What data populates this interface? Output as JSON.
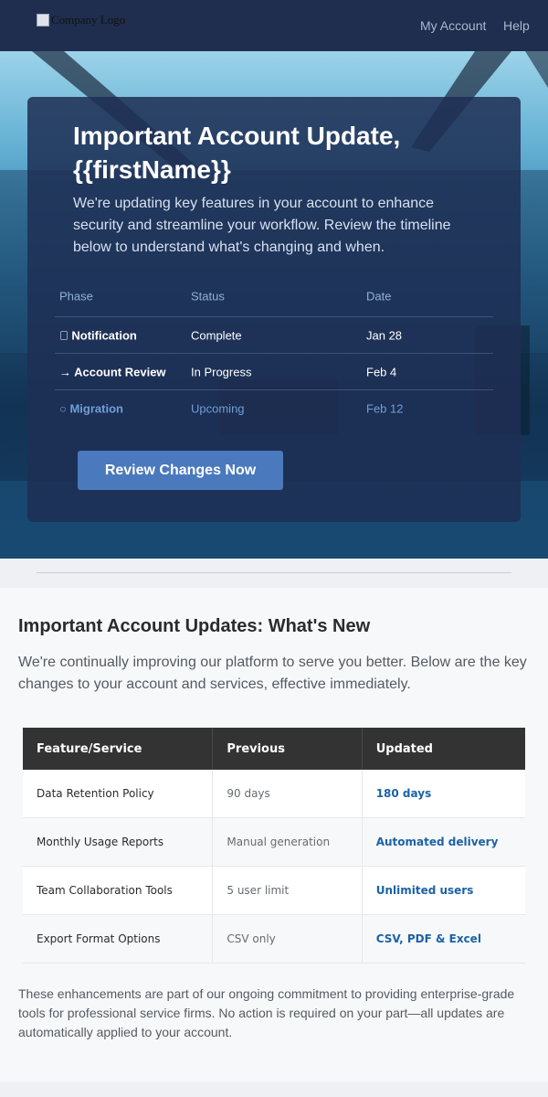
{
  "header": {
    "logo_alt": "Company Logo",
    "nav": [
      {
        "label": "My Account"
      },
      {
        "label": "Help"
      }
    ]
  },
  "hero": {
    "title": "Important Account Update, {{firstName}}",
    "subtitle": "We're updating key features in your account to enhance security and streamline your workflow. Review the timeline below to understand what's changing and when.",
    "timeline": {
      "headers": [
        "Phase",
        "Status",
        "Date"
      ],
      "rows": [
        {
          "phase": " Notification",
          "status": "Complete",
          "date": "Jan 28"
        },
        {
          "phase": "→ Account Review",
          "status": "In Progress",
          "date": "Feb 4"
        },
        {
          "phase": "○ Migration",
          "status": "Upcoming",
          "date": "Feb 12"
        }
      ]
    },
    "cta_label": "Review Changes Now"
  },
  "main": {
    "title": "Important Account Updates: What's New",
    "intro": "We're continually improving our platform to serve you better. Below are the key changes to your account and services, effective immediately.",
    "table": {
      "headers": [
        "Feature/Service",
        "Previous",
        "Updated"
      ],
      "rows": [
        {
          "feature": "Data Retention Policy",
          "previous": "90 days",
          "updated": "180 days"
        },
        {
          "feature": "Monthly Usage Reports",
          "previous": "Manual generation",
          "updated": "Automated delivery"
        },
        {
          "feature": "Team Collaboration Tools",
          "previous": "5 user limit",
          "updated": "Unlimited users"
        },
        {
          "feature": "Export Format Options",
          "previous": "CSV only",
          "updated": "CSV, PDF & Excel"
        }
      ]
    },
    "note": "These enhancements are part of our ongoing commitment to providing enterprise-grade tools for professional service firms. No action is required on your part—all updates are automatically applied to your account."
  },
  "colors": {
    "header_bg": "#1f2e4e",
    "card_bg": "#1e2f54",
    "cta_bg": "#4a79bd",
    "updated_text": "#1b62a6",
    "table_header_bg": "#333333"
  }
}
